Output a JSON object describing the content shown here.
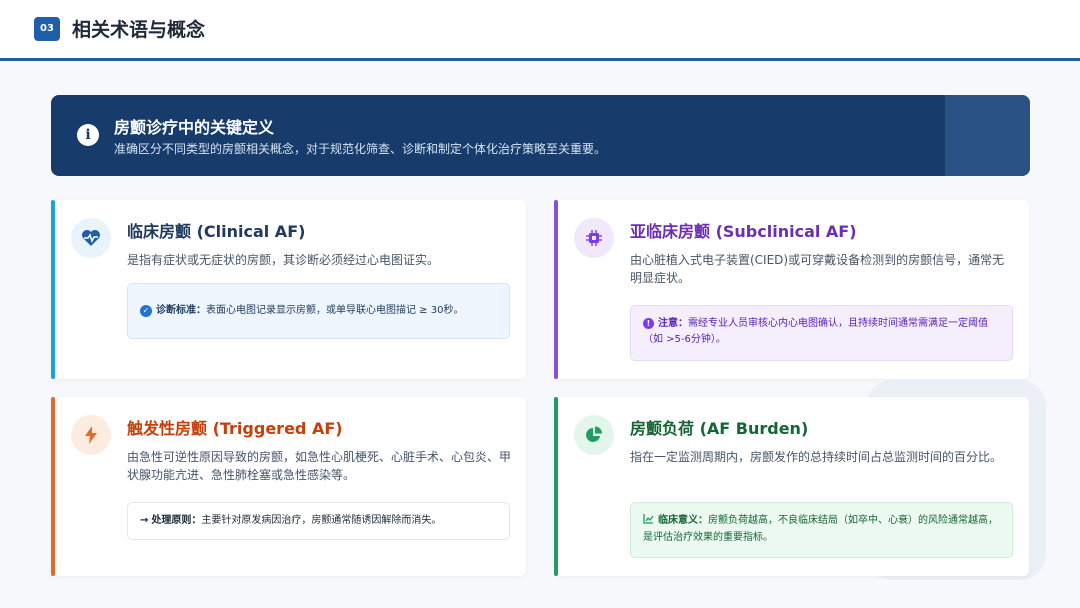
{
  "header": {
    "section_number": "03",
    "title": "相关术语与概念"
  },
  "banner": {
    "icon": "info-icon",
    "title": "房颤诊疗中的关键定义",
    "subtitle": "准确区分不同类型的房颤相关概念，对于规范化筛查、诊断和制定个体化治疗策略至关重要。"
  },
  "cards": [
    {
      "icon": "heartbeat-icon",
      "accent": "#1ba3d9",
      "title": "临床房颤 (Clinical AF)",
      "title_color": "#1e3a5f",
      "description": "是指有症状或无症状的房颤，其诊断必须经过心电图证实。",
      "note_icon": "check-circle-icon",
      "note_label": "诊断标准：",
      "note_text": "表面心电图记录显示房颤，或单导联心电图描记 ≥ 30秒。"
    },
    {
      "icon": "chip-icon",
      "accent": "#8a4fd6",
      "title": "亚临床房颤 (Subclinical AF)",
      "title_color": "#6b2fb3",
      "description": "由心脏植入式电子装置(CIED)或可穿戴设备检测到的房颤信号，通常无明显症状。",
      "note_icon": "alert-circle-icon",
      "note_label": "注意：",
      "note_text": "需经专业人员审核心内心电图确认，且持续时间通常需满足一定阈值（如 >5-6分钟）。"
    },
    {
      "icon": "lightning-icon",
      "accent": "#e06b2a",
      "title": "触发性房颤 (Triggered AF)",
      "title_color": "#c2410c",
      "description": "由急性可逆性原因导致的房颤，如急性心肌梗死、心脏手术、心包炎、甲状腺功能亢进、急性肺栓塞或急性感染等。",
      "note_icon": "arrow-right-icon",
      "note_label": "处理原则：",
      "note_text": "主要针对原发病因治疗，房颤通常随诱因解除而消失。"
    },
    {
      "icon": "pie-chart-icon",
      "accent": "#1f9d62",
      "title": "房颤负荷 (AF Burden)",
      "title_color": "#166534",
      "description": "指在一定监测周期内，房颤发作的总持续时间占总监测时间的百分比。",
      "note_icon": "trend-line-icon",
      "note_label": "临床意义：",
      "note_text": "房颤负荷越高，不良临床结局（如卒中、心衰）的风险通常越高，是评估治疗效果的重要指标。"
    }
  ]
}
